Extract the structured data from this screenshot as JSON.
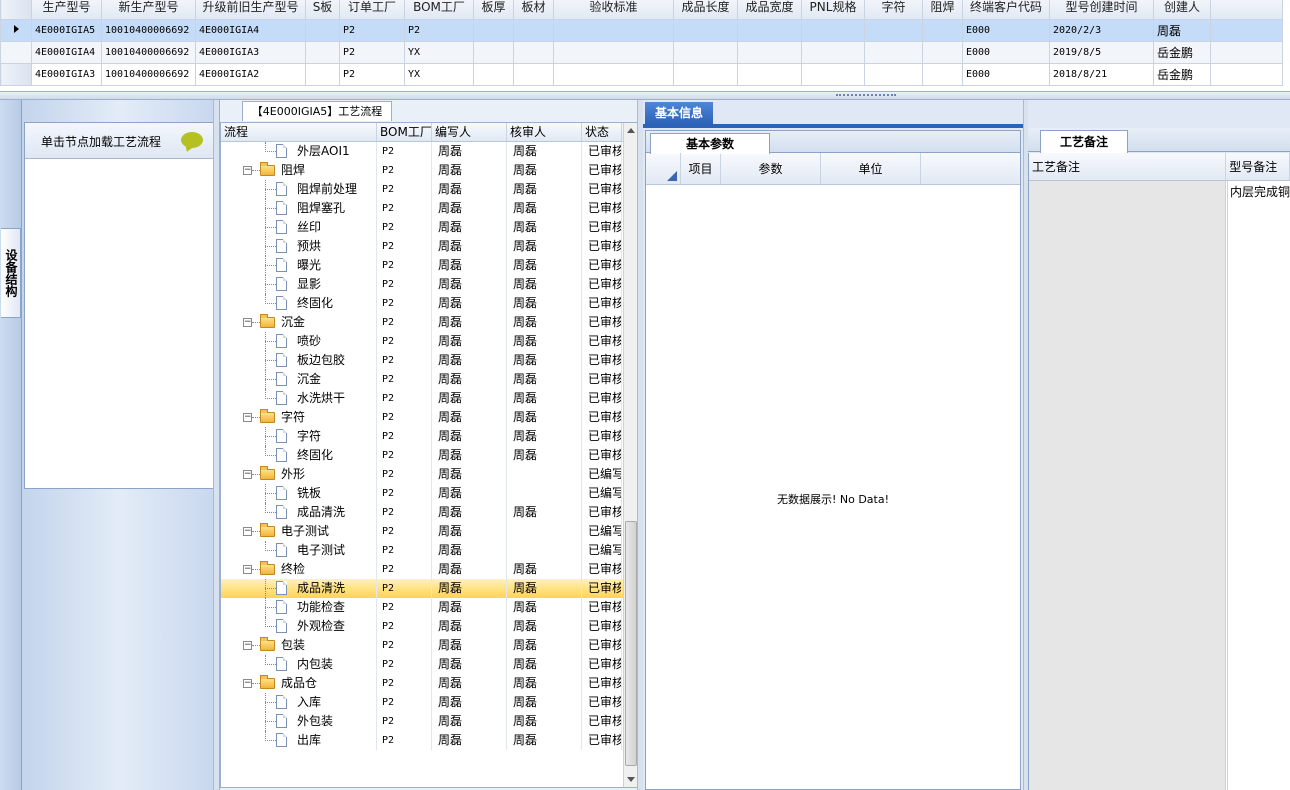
{
  "top_grid": {
    "columns": [
      "生产型号",
      "新生产型号",
      "升级前旧生产型号",
      "S板",
      "订单工厂",
      "BOM工厂",
      "板厚",
      "板材",
      "验收标准",
      "成品长度",
      "成品宽度",
      "PNL规格",
      "字符",
      "阻焊",
      "终端客户代码",
      "型号创建时间",
      "创建人"
    ],
    "rows": [
      {
        "cells": [
          "4E000IGIA5",
          "10010400006692",
          "4E000IGIA4",
          "",
          "P2",
          "P2",
          "",
          "",
          "",
          "",
          "",
          "",
          "",
          "",
          "E000",
          "2020/2/3",
          "周磊"
        ]
      },
      {
        "cells": [
          "4E000IGIA4",
          "10010400006692",
          "4E000IGIA3",
          "",
          "P2",
          "YX",
          "",
          "",
          "",
          "",
          "",
          "",
          "",
          "",
          "E000",
          "2019/8/5",
          "岳金鹏"
        ]
      },
      {
        "cells": [
          "4E000IGIA3",
          "10010400006692",
          "4E000IGIA2",
          "",
          "P2",
          "YX",
          "",
          "",
          "",
          "",
          "",
          "",
          "",
          "",
          "E000",
          "2018/8/21",
          "岳金鹏"
        ]
      }
    ]
  },
  "left_vertical_tab": {
    "label": "设备结构"
  },
  "equipment_panel": {
    "hint": "单击节点加载工艺流程"
  },
  "tree_panel": {
    "tab_label": "【4E000IGIA5】工艺流程",
    "columns": [
      "流程",
      "BOM工厂",
      "编写人",
      "核审人",
      "状态"
    ],
    "rows": [
      {
        "name": "外层AOI1",
        "type": "leaf",
        "bom": "P2",
        "writer": "周磊",
        "reviewer": "周磊",
        "status": "已审核"
      },
      {
        "name": "阻焊",
        "type": "folder",
        "bom": "P2",
        "writer": "周磊",
        "reviewer": "周磊",
        "status": "已审核"
      },
      {
        "name": "阻焊前处理",
        "type": "leaf",
        "bom": "P2",
        "writer": "周磊",
        "reviewer": "周磊",
        "status": "已审核"
      },
      {
        "name": "阻焊塞孔",
        "type": "leaf",
        "bom": "P2",
        "writer": "周磊",
        "reviewer": "周磊",
        "status": "已审核"
      },
      {
        "name": "丝印",
        "type": "leaf",
        "bom": "P2",
        "writer": "周磊",
        "reviewer": "周磊",
        "status": "已审核"
      },
      {
        "name": "预烘",
        "type": "leaf",
        "bom": "P2",
        "writer": "周磊",
        "reviewer": "周磊",
        "status": "已审核"
      },
      {
        "name": "曝光",
        "type": "leaf",
        "bom": "P2",
        "writer": "周磊",
        "reviewer": "周磊",
        "status": "已审核"
      },
      {
        "name": "显影",
        "type": "leaf",
        "bom": "P2",
        "writer": "周磊",
        "reviewer": "周磊",
        "status": "已审核"
      },
      {
        "name": "终固化",
        "type": "leaf",
        "bom": "P2",
        "writer": "周磊",
        "reviewer": "周磊",
        "status": "已审核"
      },
      {
        "name": "沉金",
        "type": "folder",
        "bom": "P2",
        "writer": "周磊",
        "reviewer": "周磊",
        "status": "已审核"
      },
      {
        "name": "喷砂",
        "type": "leaf",
        "bom": "P2",
        "writer": "周磊",
        "reviewer": "周磊",
        "status": "已审核"
      },
      {
        "name": "板边包胶",
        "type": "leaf",
        "bom": "P2",
        "writer": "周磊",
        "reviewer": "周磊",
        "status": "已审核"
      },
      {
        "name": "沉金",
        "type": "leaf",
        "bom": "P2",
        "writer": "周磊",
        "reviewer": "周磊",
        "status": "已审核"
      },
      {
        "name": "水洗烘干",
        "type": "leaf",
        "bom": "P2",
        "writer": "周磊",
        "reviewer": "周磊",
        "status": "已审核"
      },
      {
        "name": "字符",
        "type": "folder",
        "bom": "P2",
        "writer": "周磊",
        "reviewer": "周磊",
        "status": "已审核"
      },
      {
        "name": "字符",
        "type": "leaf",
        "bom": "P2",
        "writer": "周磊",
        "reviewer": "周磊",
        "status": "已审核"
      },
      {
        "name": "终固化",
        "type": "leaf",
        "bom": "P2",
        "writer": "周磊",
        "reviewer": "周磊",
        "status": "已审核"
      },
      {
        "name": "外形",
        "type": "folder",
        "bom": "P2",
        "writer": "周磊",
        "reviewer": "",
        "status": "已编写"
      },
      {
        "name": "铣板",
        "type": "leaf",
        "bom": "P2",
        "writer": "周磊",
        "reviewer": "",
        "status": "已编写"
      },
      {
        "name": "成品清洗",
        "type": "leaf",
        "bom": "P2",
        "writer": "周磊",
        "reviewer": "周磊",
        "status": "已审核"
      },
      {
        "name": "电子测试",
        "type": "folder",
        "bom": "P2",
        "writer": "周磊",
        "reviewer": "",
        "status": "已编写"
      },
      {
        "name": "电子测试",
        "type": "leaf",
        "bom": "P2",
        "writer": "周磊",
        "reviewer": "",
        "status": "已编写"
      },
      {
        "name": "终检",
        "type": "folder",
        "bom": "P2",
        "writer": "周磊",
        "reviewer": "周磊",
        "status": "已审核"
      },
      {
        "name": "成品清洗",
        "type": "leaf",
        "bom": "P2",
        "writer": "周磊",
        "reviewer": "周磊",
        "status": "已审核",
        "selected": true
      },
      {
        "name": "功能检查",
        "type": "leaf",
        "bom": "P2",
        "writer": "周磊",
        "reviewer": "周磊",
        "status": "已审核"
      },
      {
        "name": "外观检查",
        "type": "leaf",
        "bom": "P2",
        "writer": "周磊",
        "reviewer": "周磊",
        "status": "已审核"
      },
      {
        "name": "包装",
        "type": "folder",
        "bom": "P2",
        "writer": "周磊",
        "reviewer": "周磊",
        "status": "已审核"
      },
      {
        "name": "内包装",
        "type": "leaf",
        "bom": "P2",
        "writer": "周磊",
        "reviewer": "周磊",
        "status": "已审核"
      },
      {
        "name": "成品仓",
        "type": "folder",
        "bom": "P2",
        "writer": "周磊",
        "reviewer": "周磊",
        "status": "已审核"
      },
      {
        "name": "入库",
        "type": "leaf",
        "bom": "P2",
        "writer": "周磊",
        "reviewer": "周磊",
        "status": "已审核"
      },
      {
        "name": "外包装",
        "type": "leaf",
        "bom": "P2",
        "writer": "周磊",
        "reviewer": "周磊",
        "status": "已审核"
      },
      {
        "name": "出库",
        "type": "leaf",
        "bom": "P2",
        "writer": "周磊",
        "reviewer": "周磊",
        "status": "已审核"
      }
    ]
  },
  "info_panel": {
    "tab_label": "基本信息",
    "sub_tab_label": "基本参数",
    "columns": [
      "项目",
      "参数",
      "单位"
    ],
    "empty_text": "无数据展示! No Data!"
  },
  "remark_panel": {
    "tab_label": "工艺备注",
    "columns": [
      "工艺备注",
      "型号备注"
    ],
    "model_remark": "内层完成铜厚"
  },
  "colors": {
    "accent": "#2c63b8",
    "selection": "#c4dcf7",
    "tree_selection": "#ffd453"
  }
}
